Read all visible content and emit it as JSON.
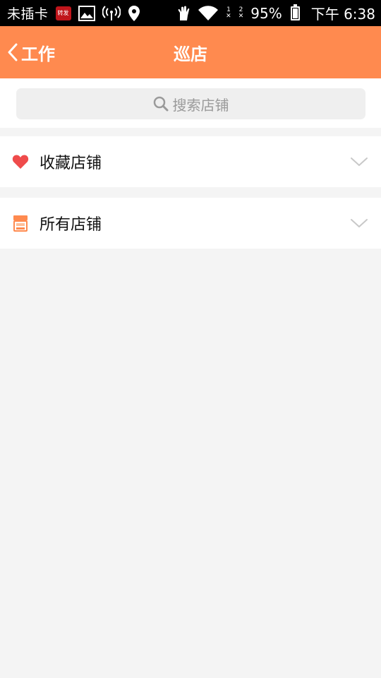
{
  "status_bar": {
    "carrier": "未插卡",
    "badge_text": "转发",
    "sim1": "1",
    "sim2": "2",
    "battery_pct": "95%",
    "time": "下午 6:38"
  },
  "navbar": {
    "back_label": "工作",
    "title": "巡店",
    "background": "#ff8a4f"
  },
  "search": {
    "placeholder": "搜索店铺"
  },
  "sections": [
    {
      "label": "收藏店铺",
      "icon": "heart-icon",
      "icon_color": "#ef4b4b"
    },
    {
      "label": "所有店铺",
      "icon": "store-icon",
      "icon_color": "#ff8a4f"
    }
  ]
}
